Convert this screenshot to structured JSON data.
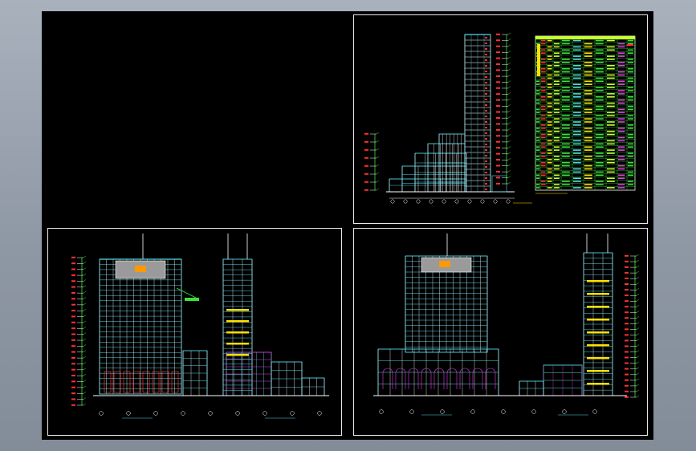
{
  "drawing": {
    "background_color": "#000000",
    "window_background": "#9aa3b0",
    "sheets": [
      {
        "id": "section",
        "views": [
          "section-with-schedule"
        ]
      },
      {
        "id": "front-and-side-elevations",
        "views": [
          "front-elevation",
          "side-elevation"
        ]
      },
      {
        "id": "rear-and-side-elevations",
        "views": [
          "rear-elevation",
          "side-elevation"
        ]
      }
    ],
    "colors": {
      "outline": "#ffffff",
      "cyan": "#4fd8e8",
      "green": "#3ce03c",
      "yellow": "#ffe000",
      "red": "#ff3030",
      "magenta": "#e040e0",
      "orange": "#ff9900",
      "lime": "#c8ff30",
      "grey": "#9a9a9a"
    }
  }
}
